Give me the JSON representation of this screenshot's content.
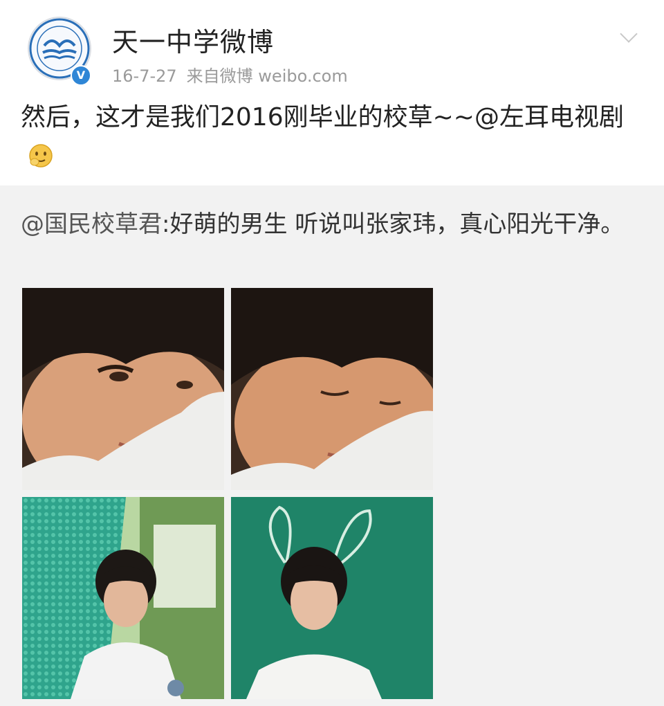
{
  "account": {
    "name": "天一中学微博",
    "avatar_icon": "school-logo-icon",
    "verified_icon": "verified-badge-icon",
    "verified_mark": "V"
  },
  "meta": {
    "date": "16-7-27",
    "source": "来自微博 weibo.com"
  },
  "post": {
    "text": "然后，这才是我们2016刚毕业的校草~~@左耳电视剧",
    "emoji_icon": "shy-face-emoji-icon"
  },
  "retweet": {
    "mention": "@国民校草君",
    "text": ":好萌的男生 听说叫张家玮，真心阳光干净。",
    "photos": [
      {
        "icon": "photo-portrait-lying-eyes-open"
      },
      {
        "icon": "photo-portrait-lying-eyes-closed"
      },
      {
        "icon": "photo-portrait-green-fence"
      },
      {
        "icon": "photo-portrait-chalkboard-bunny-ears"
      }
    ]
  },
  "menu_icon": "chevron-down-icon",
  "colors": {
    "verified": "#2f86d6",
    "retweet_bg": "#f2f2f2",
    "meta_text": "#9a9a9a"
  }
}
